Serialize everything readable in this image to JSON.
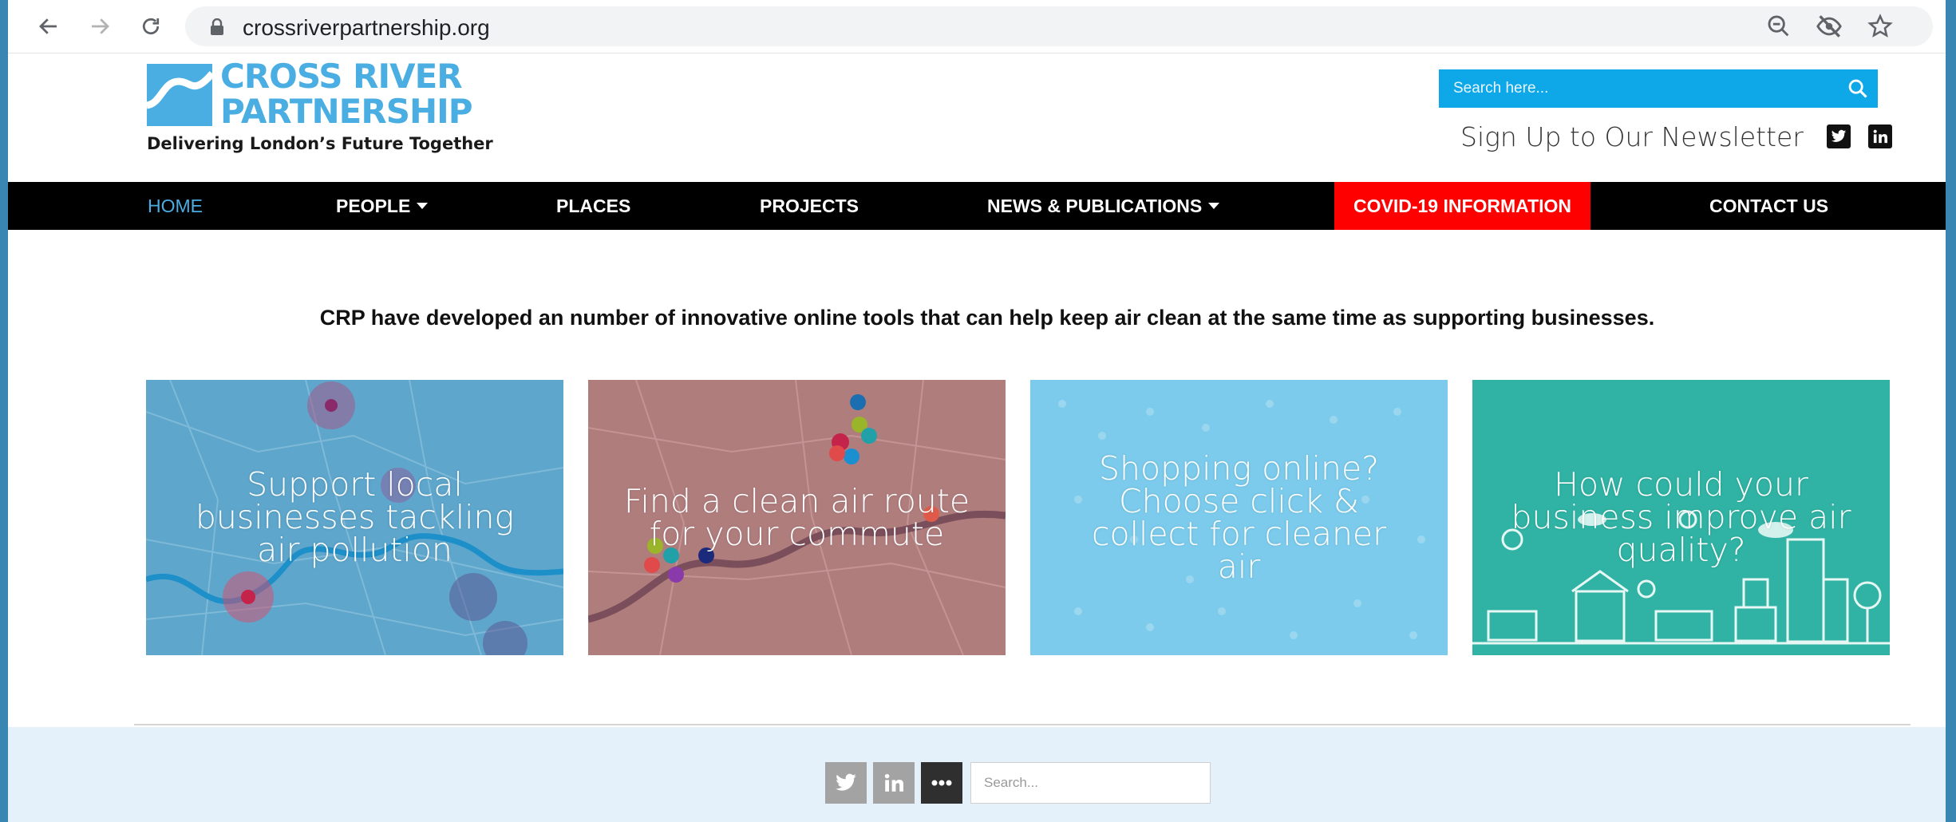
{
  "browser": {
    "url": "crossriverpartnership.org",
    "icons": [
      "back-icon",
      "forward-icon",
      "reload-icon",
      "lock-icon",
      "zoom-out-icon",
      "eye-off-icon",
      "star-icon"
    ]
  },
  "header": {
    "logo_line1": "CROSS RIVER",
    "logo_line2": "PARTNERSHIP",
    "logo_tagline": "Delivering London’s Future Together",
    "search_placeholder": "Search here...",
    "newsletter": "Sign Up to Our Newsletter",
    "social": [
      "twitter-icon",
      "linkedin-icon"
    ]
  },
  "nav": {
    "items": [
      {
        "label": "HOME",
        "active": true
      },
      {
        "label": "PEOPLE",
        "dropdown": true
      },
      {
        "label": "PLACES"
      },
      {
        "label": "PROJECTS"
      },
      {
        "label": "NEWS & PUBLICATIONS",
        "dropdown": true
      },
      {
        "label": "COVID-19 INFORMATION",
        "highlight": "#ff0000"
      },
      {
        "label": "CONTACT US"
      }
    ],
    "active_color": "#4aaee3"
  },
  "main": {
    "intro": "CRP have developed an number of innovative online tools that can help keep air clean at the same time as supporting businesses.",
    "tiles": [
      {
        "lines": [
          "Support local",
          "businesses tackling",
          "air pollution"
        ],
        "color": "#5ea6cc"
      },
      {
        "lines": [
          "Find a clean air route",
          "for your commute"
        ],
        "color": "#b07d7d"
      },
      {
        "lines": [
          "Shopping online?",
          "Choose click &",
          "collect for cleaner",
          "air"
        ],
        "color": "#7ccbec"
      },
      {
        "lines": [
          "How could your",
          "business improve air",
          "quality?"
        ],
        "color": "#30b3a4"
      }
    ]
  },
  "footer": {
    "share": [
      "twitter-icon",
      "linkedin-icon",
      "more-icon"
    ],
    "search_placeholder": "Search..."
  },
  "colors": {
    "brand_blue": "#4aaee3",
    "search_blue": "#0ea7e8",
    "nav_bg": "#000000",
    "footer_bg": "#e4f0fa"
  }
}
